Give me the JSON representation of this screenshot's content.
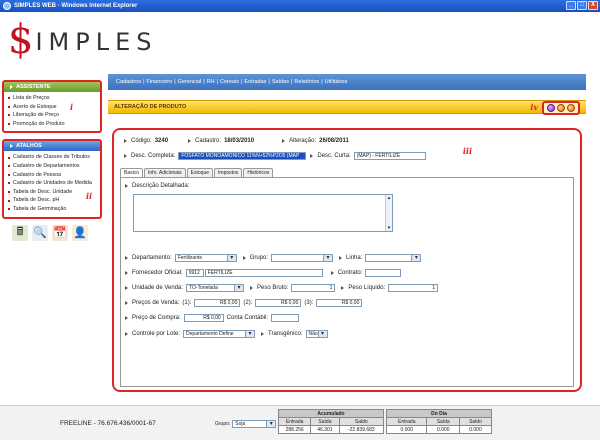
{
  "window": {
    "title": "SIMPLES WEB - Windows Internet Explorer",
    "controls": [
      "_",
      "□",
      "X"
    ]
  },
  "logo": {
    "symbol": "$",
    "text": "IMPLES"
  },
  "sidebar": {
    "assistente": {
      "title": "ASSISTENTE",
      "marker": "i",
      "items": [
        "Lista de Preços",
        "Acerto de Estoque",
        "Liberação de Preço",
        "Promoção do Produto"
      ]
    },
    "atalhos": {
      "title": "ATALHOS",
      "marker": "ii",
      "items": [
        "Cadastro de Classes de Tributos",
        "Cadastro de Departamentos",
        "Cadastro de Pessoa",
        "Cadastro de Unidades de Medida",
        "Tabela de Desc. Unidade",
        "Tabela de Desc. pH",
        "Tabela de Germinação"
      ]
    },
    "tool_icons": [
      "calculator-icon",
      "search-icon",
      "calendar-icon",
      "user-icon"
    ]
  },
  "menu": {
    "items": [
      "Cadastros",
      "Financeiro",
      "Gerencial",
      "RH",
      "Cereais",
      "Entradas",
      "Saídas",
      "Relatórios",
      "Utilitários"
    ],
    "separator": "|"
  },
  "section": {
    "title": "ALTERAÇÃO DE PRODUTO",
    "marker": "iv"
  },
  "form": {
    "marker": "iii",
    "codigo_label": "Código:",
    "codigo": "3240",
    "cadastro_label": "Cadastro:",
    "cadastro": "18/03/2010",
    "alteracao_label": "Alteração:",
    "alteracao": "26/08/2011",
    "desc_completa_label": "Desc. Completa:",
    "desc_completa": "FOSFATO MONOAMONICO 11%N+52%P2O5 (MAP",
    "desc_curta_label": "Desc. Curta:",
    "desc_curta": "(MAP) - FERTILIZE",
    "tabs": [
      "Basico",
      "Info. Adicionais",
      "Estoque",
      "Impostos",
      "Históricos"
    ],
    "descricao_label": "Descrição Detalhada:",
    "departamento_label": "Departamento:",
    "departamento": "Fertilizante",
    "grupo_label": "Grupo:",
    "grupo": "",
    "linha_label": "Linha:",
    "linha": "",
    "fornecedor_label": "Fornecedor Oficial:",
    "fornecedor_code": "9912",
    "fornecedor_name": "FERTILIZE",
    "contrato_label": "Contrato:",
    "contrato": "",
    "unidade_label": "Unidade de Venda:",
    "unidade": "TO-Tonelada",
    "peso_bruto_label": "Peso Bruto:",
    "peso_bruto": "1",
    "peso_liquido_label": "Peso Líquido:",
    "peso_liquido": "1",
    "precos_label": "Preços de Venda:",
    "preco1_label": "(1):",
    "preco1": "R$ 0,00",
    "preco2_label": "(2):",
    "preco2": "R$ 0,00",
    "preco3_label": "(3):",
    "preco3": "R$ 0,00",
    "preco_compra_label": "Preço de Compra:",
    "preco_compra": "R$ 0,00",
    "conta_label": "Conta Contábil:",
    "conta": "",
    "controle_label": "Controle por Lote:",
    "controle": "Departamento Define",
    "transgenico_label": "Transgênico:",
    "transgenico": "Não"
  },
  "footer": {
    "company": "FREELINE - 76.676.436/0001-67",
    "grupo_label": "Grupo:",
    "grupo_value": "Soja",
    "acumulado": {
      "title": "Acumulado",
      "headers": [
        "Entrada",
        "Saída",
        "Saldo"
      ],
      "values": [
        "288.256",
        "46.301",
        "-22.839.683"
      ]
    },
    "dodia": {
      "title": "Do Dia",
      "headers": [
        "Entrada",
        "Saída",
        "Saldo"
      ],
      "values": [
        "0.000",
        "0.000",
        "0.000"
      ]
    }
  }
}
